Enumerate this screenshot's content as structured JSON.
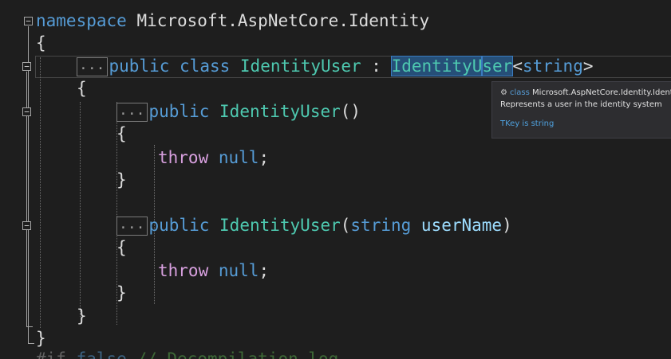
{
  "editor": {
    "namespace_keyword": "namespace",
    "namespace_name": "Microsoft.AspNetCore.Identity",
    "open_brace": "{",
    "close_brace": "}",
    "collapsed_marker": "...",
    "class_line": {
      "public": "public",
      "class": "class",
      "name": "IdentityUser",
      "colon": ":",
      "base_selected": "IdentityU",
      "base_rest": "ser",
      "generic_open": "<",
      "generic_type": "string",
      "generic_close": ">"
    },
    "ctor1": {
      "public": "public",
      "name": "IdentityUser",
      "params": "()"
    },
    "ctor2": {
      "public": "public",
      "name": "IdentityUser",
      "paren_open": "(",
      "param_type": "string",
      "param_name": "userName",
      "paren_close": ")"
    },
    "throw_stmt": {
      "throw": "throw",
      "null": "null",
      "semicolon": ";"
    },
    "bottom_partial": {
      "directive": "#if",
      "value": "false",
      "comment": "// Decompilation log"
    },
    "fold_expanded": "−",
    "fold_collapsed": "+"
  },
  "tooltip": {
    "kind": "class",
    "full_name": "Microsoft.AspNetCore.Identity.IdentityUser",
    "description": "Represents a user in the identity system",
    "tkey_label": "TKey is",
    "tkey_value": "string",
    "icon": "class-icon"
  },
  "colors": {
    "background": "#1e1e1e",
    "keyword": "#569cd6",
    "type": "#4ec9b0",
    "method": "#dcdcaa",
    "control": "#d8a0df",
    "selection": "#264f78"
  }
}
